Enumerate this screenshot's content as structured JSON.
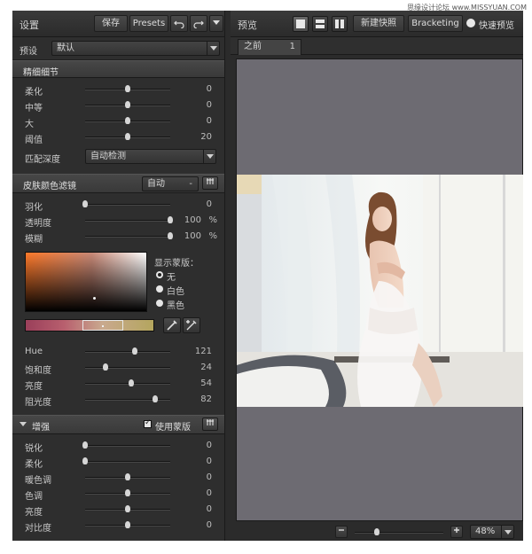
{
  "left_panel": {
    "title": "设置",
    "toolbar": {
      "save_label": "保存",
      "presets_label": "Presets"
    },
    "preset": {
      "label": "预设",
      "value": "默认"
    },
    "section_fine": {
      "title": "精细细节",
      "sliders": [
        {
          "label": "柔化",
          "value": "0"
        },
        {
          "label": "中等",
          "value": "0"
        },
        {
          "label": "大",
          "value": "0"
        },
        {
          "label": "阈值",
          "value": "20"
        }
      ],
      "depth_label": "匹配深度",
      "depth_value": "自动检测"
    },
    "section_skin": {
      "title": "皮肤颜色滤镜",
      "mode_value": "自动",
      "sliders": [
        {
          "label": "羽化",
          "value": "0"
        },
        {
          "label": "透明度",
          "value": "100",
          "unit": "%"
        },
        {
          "label": "模糊",
          "value": "100",
          "unit": "%"
        }
      ],
      "show_mask": {
        "header": "显示蒙版：",
        "options": [
          "无",
          "白色",
          "黑色"
        ],
        "selected": "无"
      },
      "hsl_sliders": [
        {
          "label": "Hue",
          "value": "121"
        },
        {
          "label": "饱和度",
          "value": "24"
        },
        {
          "label": "亮度",
          "value": "54"
        },
        {
          "label": "阻光度",
          "value": "82"
        }
      ]
    },
    "section_enhance": {
      "title": "增强",
      "use_mask_label": "使用蒙版",
      "sliders": [
        {
          "label": "锐化",
          "value": "0"
        },
        {
          "label": "柔化",
          "value": "0"
        },
        {
          "label": "暖色调",
          "value": "0"
        },
        {
          "label": "色调",
          "value": "0"
        },
        {
          "label": "亮度",
          "value": "0"
        },
        {
          "label": "对比度",
          "value": "0"
        }
      ]
    }
  },
  "right_panel": {
    "title": "预览",
    "new_snapshot_label": "新建快照",
    "bracketing_label": "Bracketing",
    "quick_preview_label": "快速预览",
    "tab_label": "之前",
    "tab_close": "1",
    "zoom_value": "48%"
  },
  "watermark": "思缘设计论坛 www.MISSYUAN.COM"
}
